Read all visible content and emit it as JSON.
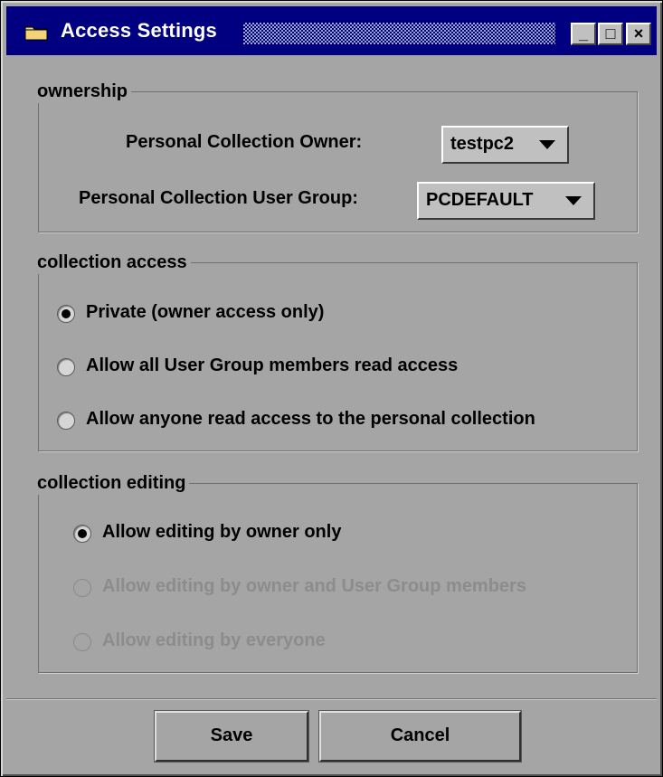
{
  "window": {
    "title": "Access Settings",
    "controls": {
      "minimize": "_",
      "maximize": "□",
      "close": "×"
    },
    "icon": "folder-icon",
    "colors": {
      "titlebar": "#000080",
      "background": "#a5a5a5",
      "disabled_text": "#8c8c8c"
    }
  },
  "ownership": {
    "legend": "ownership",
    "owner_label": "Personal Collection Owner:",
    "owner_value": "testpc2",
    "group_label": "Personal Collection User Group:",
    "group_value": "PCDEFAULT"
  },
  "collection_access": {
    "legend": "collection access",
    "options": [
      {
        "label": "Private (owner access only)",
        "checked": true,
        "enabled": true
      },
      {
        "label": "Allow all User Group members read access",
        "checked": false,
        "enabled": true
      },
      {
        "label": "Allow anyone read access to the personal collection",
        "checked": false,
        "enabled": true
      }
    ]
  },
  "collection_editing": {
    "legend": "collection editing",
    "options": [
      {
        "label": "Allow editing by owner only",
        "checked": true,
        "enabled": true
      },
      {
        "label": "Allow editing by owner and User Group members",
        "checked": false,
        "enabled": false
      },
      {
        "label": "Allow editing by everyone",
        "checked": false,
        "enabled": false
      }
    ]
  },
  "buttons": {
    "save": "Save",
    "cancel": "Cancel"
  }
}
